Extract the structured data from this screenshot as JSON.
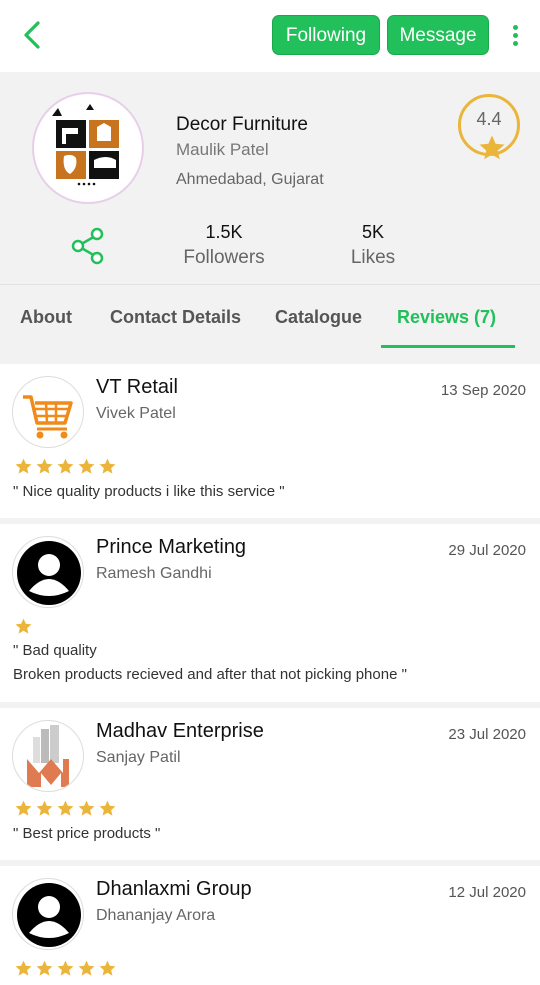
{
  "header": {
    "following_label": "Following",
    "message_label": "Message"
  },
  "profile": {
    "business_name": "Decor Furniture",
    "owner": "Maulik Patel",
    "location": "Ahmedabad, Gujarat",
    "rating": "4.4",
    "followers_count": "1.5K",
    "followers_label": "Followers",
    "likes_count": "5K",
    "likes_label": "Likes"
  },
  "tabs": [
    {
      "label": "About"
    },
    {
      "label": "Contact Details"
    },
    {
      "label": "Catalogue"
    },
    {
      "label": "Reviews (7)",
      "active": true
    }
  ],
  "reviews": [
    {
      "business": "VT Retail",
      "person": "Vivek Patel",
      "date": "13 Sep 2020",
      "stars": 5,
      "avatar": "shopping-cart-icon",
      "text": "\" Nice quality products i like this service \""
    },
    {
      "business": "Prince Marketing",
      "person": "Ramesh Gandhi",
      "date": "29 Jul 2020",
      "stars": 1,
      "avatar": "user-icon",
      "text": "\" Bad quality\nBroken products recieved and after that not picking phone \""
    },
    {
      "business": "Madhav Enterprise",
      "person": "Sanjay Patil",
      "date": "23 Jul 2020",
      "stars": 5,
      "avatar": "building-logo-icon",
      "text": "\" Best price products \""
    },
    {
      "business": "Dhanlaxmi Group",
      "person": "Dhananjay Arora",
      "date": "12 Jul 2020",
      "stars": 5,
      "avatar": "user-icon",
      "text": ""
    }
  ],
  "colors": {
    "accent": "#22c05a",
    "star": "#eab53a"
  }
}
